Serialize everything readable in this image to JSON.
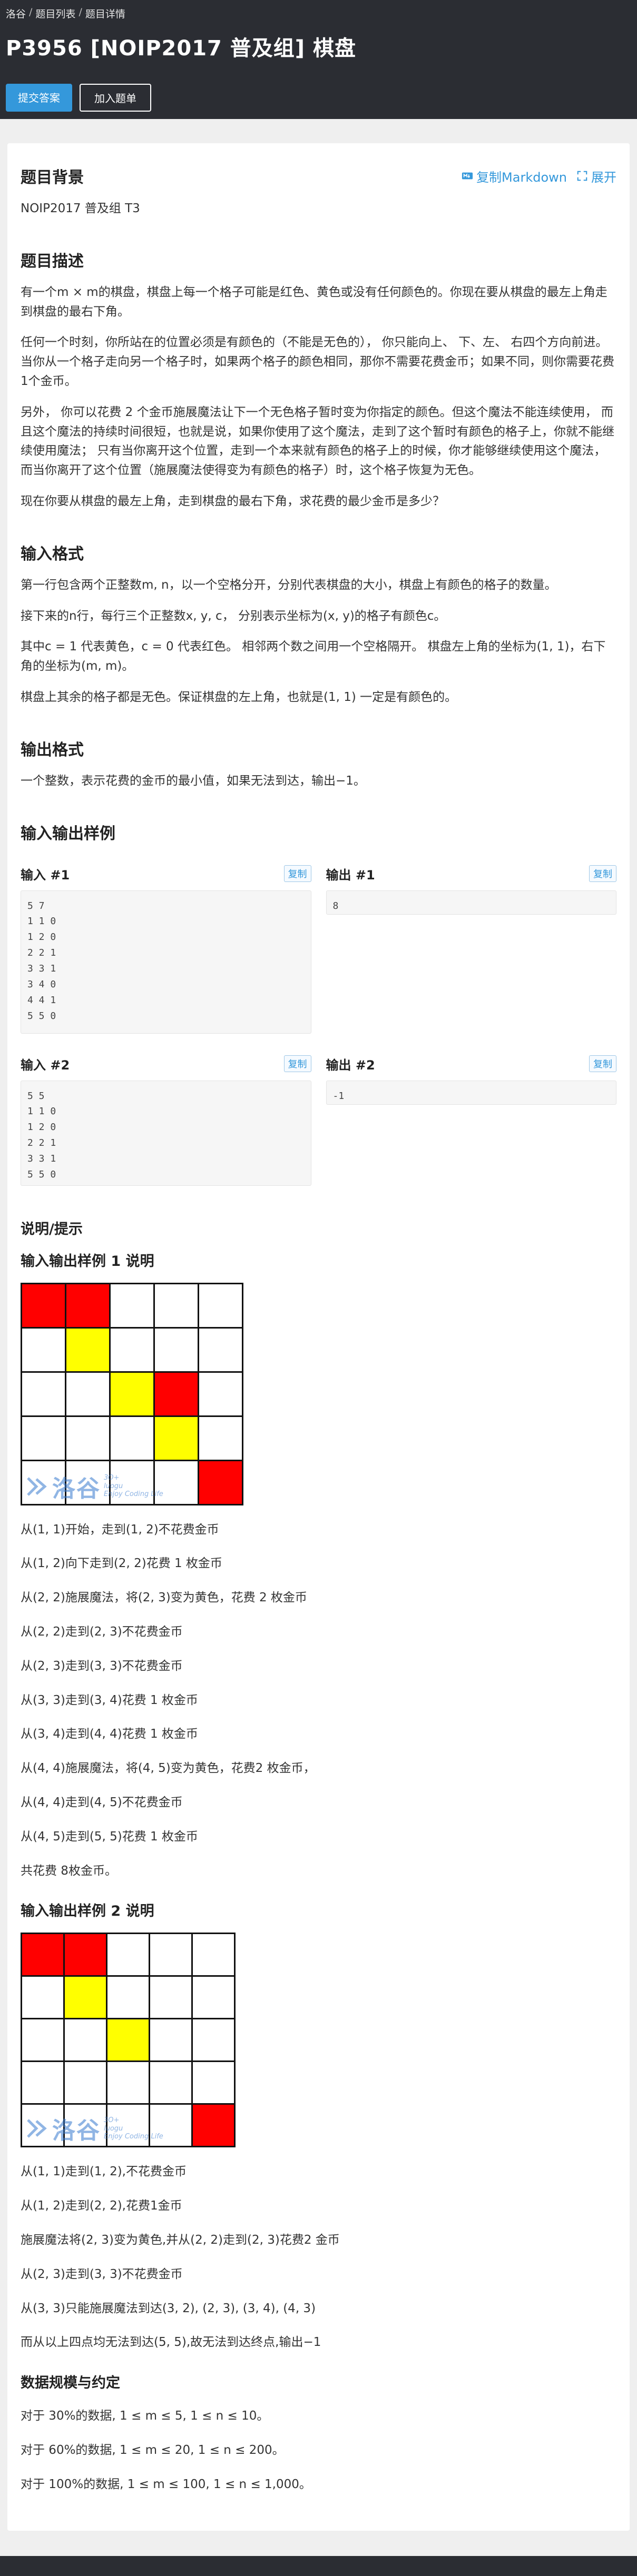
{
  "breadcrumb": [
    "洛谷",
    "题目列表",
    "题目详情"
  ],
  "title": "P3956 [NOIP2017 普及组] 棋盘",
  "actions": {
    "submit": "提交答案",
    "add_list": "加入题单"
  },
  "tools": {
    "copy_md": "复制Markdown",
    "expand": "展开"
  },
  "background": {
    "heading": "题目背景",
    "text": "NOIP2017 普及组 T3"
  },
  "description": {
    "heading": "题目描述",
    "p1": "有一个m × m的棋盘，棋盘上每一个格子可能是红色、黄色或没有任何颜色的。你现在要从棋盘的最左上角走到棋盘的最右下角。",
    "p2": "任何一个时刻，你所站在的位置必须是有颜色的（不能是无色的）， 你只能向上、 下、左、 右四个方向前进。当你从一个格子走向另一个格子时，如果两个格子的颜色相同，那你不需要花费金币；如果不同，则你需要花费 1个金币。",
    "p3": "另外， 你可以花费 2 个金币施展魔法让下一个无色格子暂时变为你指定的颜色。但这个魔法不能连续使用， 而且这个魔法的持续时间很短，也就是说，如果你使用了这个魔法，走到了这个暂时有颜色的格子上，你就不能继续使用魔法； 只有当你离开这个位置，走到一个本来就有颜色的格子上的时候，你才能够继续使用这个魔法，而当你离开了这个位置（施展魔法使得变为有颜色的格子）时，这个格子恢复为无色。",
    "p4": "现在你要从棋盘的最左上角，走到棋盘的最右下角，求花费的最少金币是多少？"
  },
  "input_format": {
    "heading": "输入格式",
    "p1": "第一行包含两个正整数m, n，以一个空格分开，分别代表棋盘的大小，棋盘上有颜色的格子的数量。",
    "p2": "接下来的n行，每行三个正整数x, y, c， 分别表示坐标为(x, y)的格子有颜色c。",
    "p3": "其中c = 1 代表黄色，c = 0 代表红色。 相邻两个数之间用一个空格隔开。 棋盘左上角的坐标为(1, 1)，右下角的坐标为(m, m)。",
    "p4": "棋盘上其余的格子都是无色。保证棋盘的左上角，也就是(1, 1) 一定是有颜色的。"
  },
  "output_format": {
    "heading": "输出格式",
    "p1": "一个整数，表示花费的金币的最小值，如果无法到达，输出−1。"
  },
  "samples": {
    "heading": "输入输出样例",
    "copy": "复制",
    "list": [
      {
        "in_label": "输入 #1",
        "in": "5 7\n1 1 0\n1 2 0\n2 2 1\n3 3 1\n3 4 0\n4 4 1\n5 5 0",
        "out_label": "输出 #1",
        "out": "8"
      },
      {
        "in_label": "输入 #2",
        "in": "5 5\n1 1 0\n1 2 0\n2 2 1\n3 3 1\n5 5 0",
        "out_label": "输出 #2",
        "out": "-1"
      }
    ]
  },
  "hint": {
    "heading": "说明/提示",
    "ex1_heading": "输入输出样例 1 说明",
    "grid1": [
      "r",
      "r",
      "w",
      "w",
      "w",
      "w",
      "y",
      "w",
      "w",
      "w",
      "w",
      "w",
      "y",
      "r",
      "w",
      "w",
      "w",
      "w",
      "y",
      "w",
      "w",
      "w",
      "w",
      "w",
      "r"
    ],
    "ex1_steps": [
      "从(1, 1)开始，走到(1, 2)不花费金币",
      "从(1, 2)向下走到(2, 2)花费 1 枚金币",
      "从(2, 2)施展魔法，将(2, 3)变为黄色，花费 2 枚金币",
      "从(2, 2)走到(2, 3)不花费金币",
      "从(2, 3)走到(3, 3)不花费金币",
      "从(3, 3)走到(3, 4)花费 1 枚金币",
      "从(3, 4)走到(4, 4)花费 1 枚金币",
      "从(4, 4)施展魔法，将(4, 5)变为黄色，花费2 枚金币，",
      "从(4, 4)走到(4, 5)不花费金币",
      "从(4, 5)走到(5, 5)花费 1 枚金币",
      "共花费 8枚金币。"
    ],
    "ex2_heading": "输入输出样例 2 说明",
    "grid2": [
      "r",
      "r",
      "w",
      "w",
      "w",
      "w",
      "y",
      "w",
      "w",
      "w",
      "w",
      "w",
      "y",
      "w",
      "w",
      "w",
      "w",
      "w",
      "w",
      "w",
      "w",
      "w",
      "w",
      "w",
      "r"
    ],
    "ex2_steps": [
      "从(1, 1)走到(1, 2),不花费金币",
      "从(1, 2)走到(2, 2),花费1金币",
      "施展魔法将(2, 3)变为黄色,并从(2, 2)走到(2, 3)花费2 金币",
      "从(2, 3)走到(3, 3)不花费金币",
      "从(3, 3)只能施展魔法到达(3, 2), (2, 3), (3, 4), (4, 3)",
      "而从以上四点均无法到达(5, 5),故无法到达终点,输出−1"
    ],
    "watermark": {
      "big": "洛谷",
      "small1": "luogu",
      "small2": "Enjoy Coding Life",
      "mark": "3O+"
    }
  },
  "constraints": {
    "heading": "数据规模与约定",
    "lines": [
      "对于 30%的数据, 1 ≤ m ≤ 5, 1 ≤ n ≤ 10。",
      "对于 60%的数据, 1 ≤ m ≤ 20, 1 ≤ n ≤ 200。",
      "对于 100%的数据, 1 ≤ m ≤ 100, 1 ≤ n ≤ 1,000。"
    ]
  },
  "colors": {
    "accent": "#3498db",
    "header_bg": "#2b2d33",
    "red": "#ff0000",
    "yellow": "#ffff00"
  }
}
